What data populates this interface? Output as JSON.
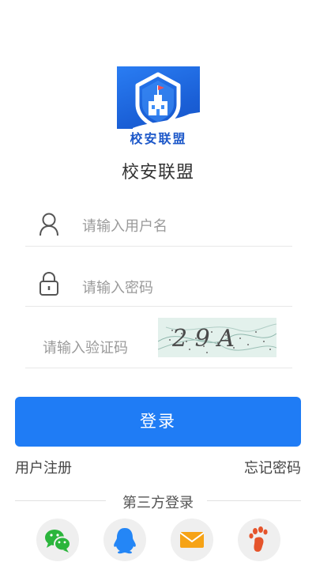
{
  "app": {
    "name": "校安联盟",
    "logo_text": "校安联盟"
  },
  "form": {
    "username_placeholder": "请输入用户名",
    "password_placeholder": "请输入密码",
    "captcha_placeholder": "请输入验证码",
    "captcha_text": "2 9 A"
  },
  "actions": {
    "login_label": "登录",
    "register_label": "用户注册",
    "forgot_label": "忘记密码"
  },
  "third_party": {
    "title": "第三方登录",
    "providers": [
      {
        "name": "wechat-icon",
        "color": "#2bb53c"
      },
      {
        "name": "qq-icon",
        "color": "#2486f6"
      },
      {
        "name": "email-icon",
        "color": "#f6a316"
      },
      {
        "name": "baidu-icon",
        "color": "#e5542b"
      }
    ]
  }
}
